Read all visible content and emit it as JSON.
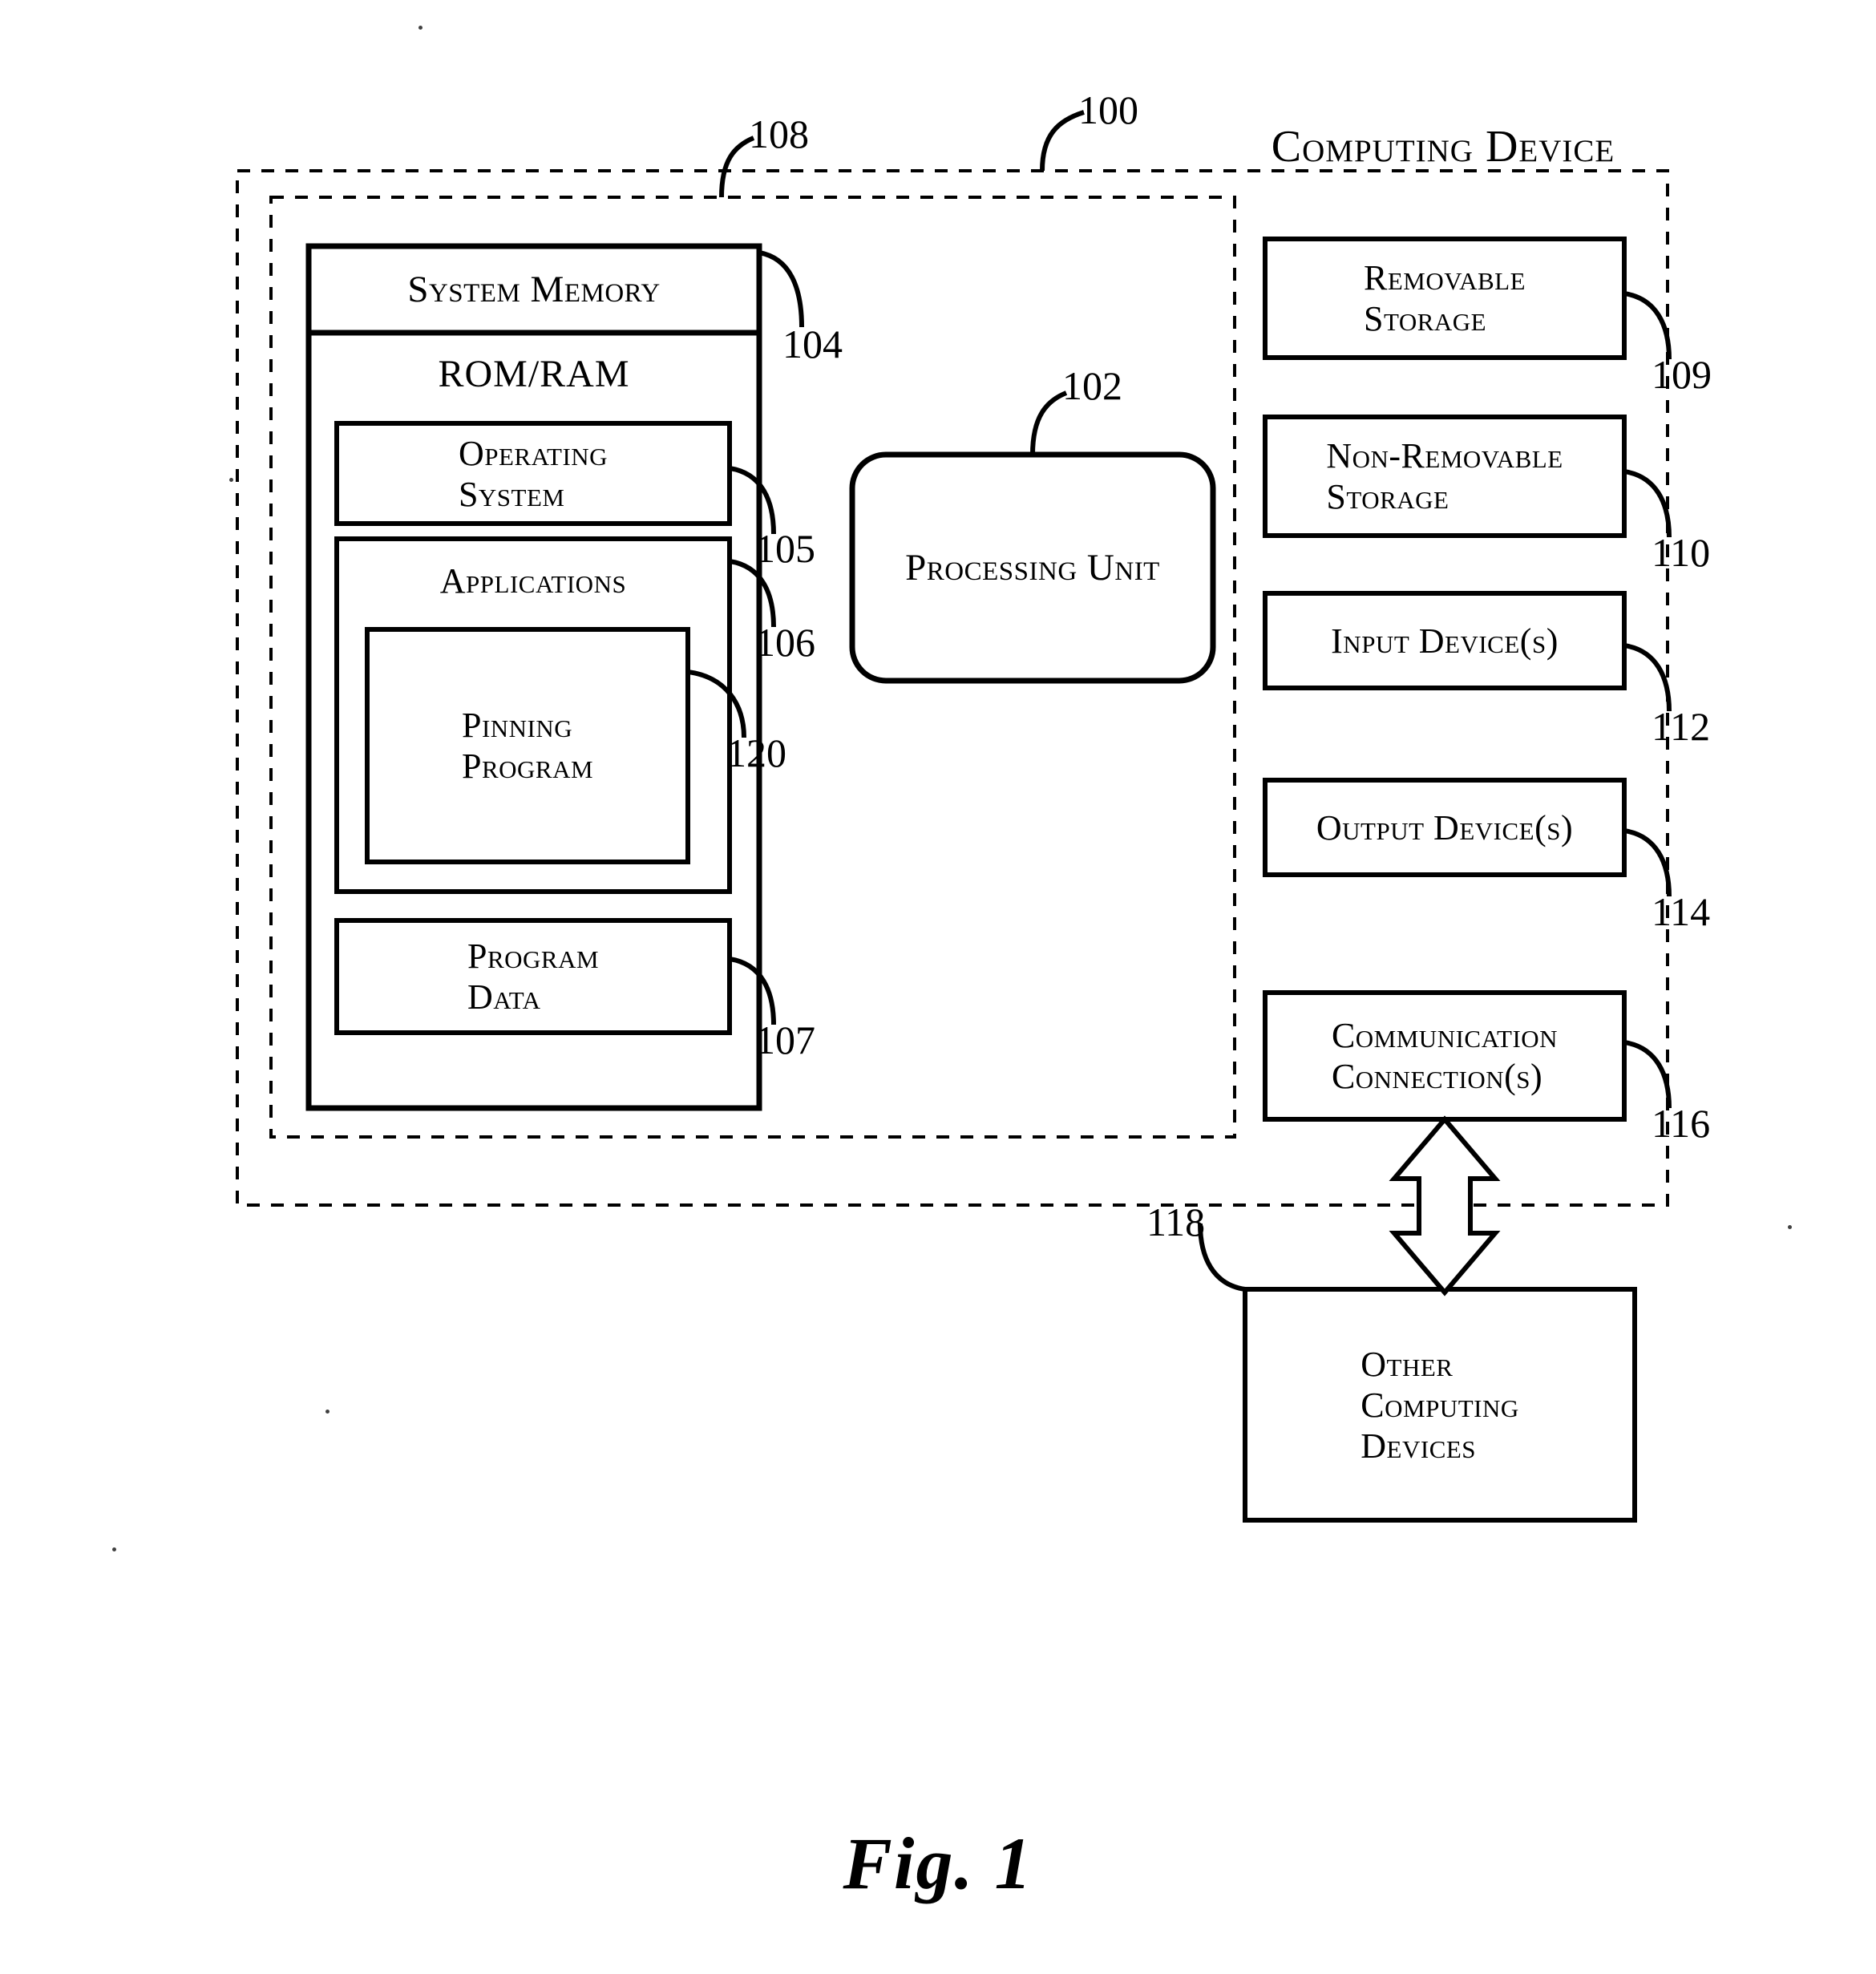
{
  "figure": {
    "caption": "Fig. 1",
    "title": "Computing Device",
    "title_ref": "100",
    "outer_dashed_ref": "108"
  },
  "memory": {
    "system_memory_label": "System Memory",
    "system_memory_ref": "104",
    "rom_ram_label": "ROM/RAM",
    "operating_system_label": "Operating\nSystem",
    "operating_system_ref": "105",
    "applications_label": "Applications",
    "applications_ref": "106",
    "pinning_program_label": "Pinning\nProgram",
    "pinning_program_ref": "120",
    "program_data_label": "Program\nData",
    "program_data_ref": "107"
  },
  "processing": {
    "label": "Processing Unit",
    "ref": "102"
  },
  "peripherals": [
    {
      "label": "Removable\nStorage",
      "ref": "109"
    },
    {
      "label": "Non-Removable\nStorage",
      "ref": "110"
    },
    {
      "label": "Input Device(s)",
      "ref": "112"
    },
    {
      "label": "Output Device(s)",
      "ref": "114"
    },
    {
      "label": "Communication\nConnection(s)",
      "ref": "116"
    }
  ],
  "external": {
    "label": "Other\nComputing\nDevices",
    "ref": "118"
  },
  "colors": {
    "ink": "#000000",
    "paper": "#ffffff"
  }
}
